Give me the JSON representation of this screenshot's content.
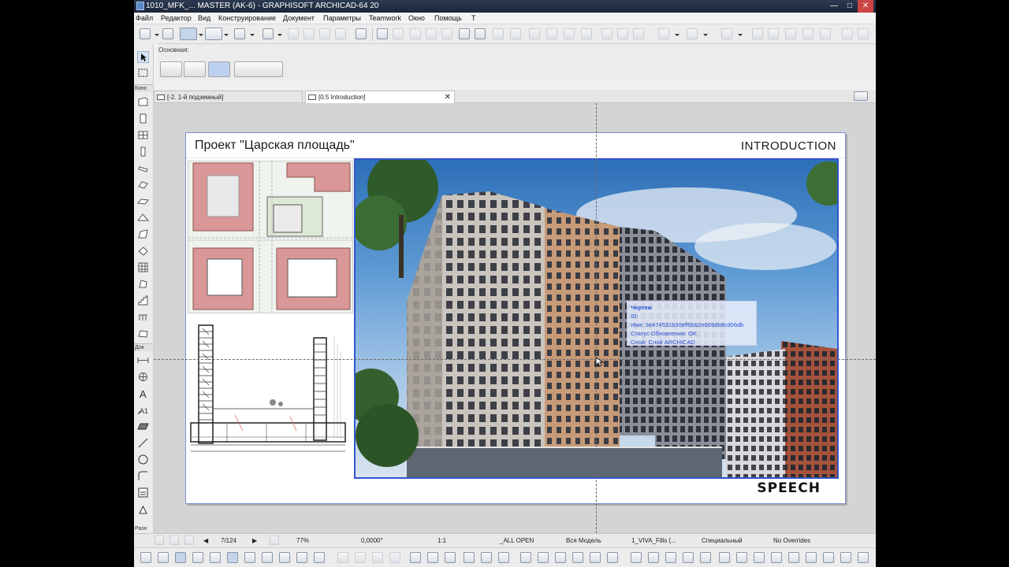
{
  "window": {
    "title": "1010_MFK_... MASTER (AK-6) - GRAPHISOFT ARCHICAD-64 20",
    "controls": [
      "—",
      "□",
      "✕"
    ]
  },
  "menu": [
    "Файл",
    "Редактор",
    "Вид",
    "Конструирование",
    "Документ",
    "Параметры",
    "Teamwork",
    "Окно",
    "Помощь",
    "T"
  ],
  "infobox": {
    "label": "Основная:"
  },
  "toolbox": {
    "sections": [
      "Конс",
      "Док",
      "Разн"
    ]
  },
  "tabs": [
    {
      "label": "[-2. 1-й подземный]",
      "active": false
    },
    {
      "label": "[0.5 Introduction]",
      "active": true,
      "close": "✕"
    }
  ],
  "sheet": {
    "title": "Проект \"Царская площадь\"",
    "section": "INTRODUCTION",
    "logo": "SPEECH"
  },
  "tooltip": {
    "heading": "Чертеж",
    "id_line": "ID:",
    "name_line": "Имя: 3e474531b30eff6bb2e669db8cd06db",
    "status_line": "Статус Обновления: OK",
    "layer_line": "Слой: Слой ARCHICAD"
  },
  "statusbar": {
    "page": "7/124",
    "zoom": "77%",
    "angle": "0,0000°",
    "scale": "1:1",
    "layer_combo": "_ALL OPEN",
    "model": "Вся Модель",
    "pen_set": "1_VIVA_Fills (...",
    "mvo": "Специальный",
    "overrides": "No Overrides"
  },
  "colors": {
    "accent": "#3355cc",
    "tooltip_text": "#2b52d3",
    "titlebar": "#1d2638"
  }
}
